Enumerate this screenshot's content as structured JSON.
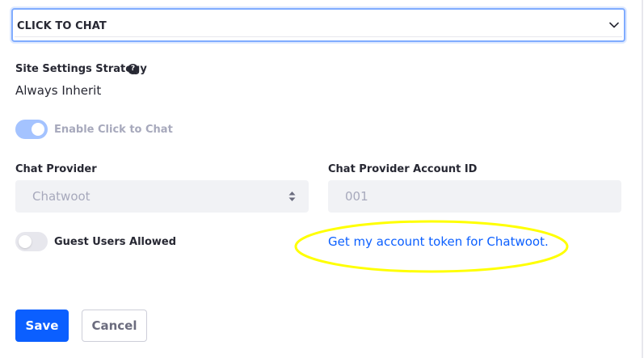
{
  "panel": {
    "title": "CLICK TO CHAT",
    "chevron_icon": "chevron-down-icon"
  },
  "site_settings": {
    "label": "Site Settings Strategy",
    "help_icon": "question-icon",
    "help_glyph": "?",
    "value": "Always Inherit"
  },
  "enable_toggle": {
    "label": "Enable Click to Chat",
    "checked": true,
    "disabled": true
  },
  "chat_provider": {
    "label": "Chat Provider",
    "selected": "Chatwoot"
  },
  "account_id": {
    "label": "Chat Provider Account ID",
    "value": "001"
  },
  "guest_toggle": {
    "label": "Guest Users Allowed",
    "checked": false
  },
  "token_link": {
    "text": "Get my account token for Chatwoot."
  },
  "highlight_color": "#ffff00",
  "actions": {
    "save": "Save",
    "cancel": "Cancel"
  },
  "colors": {
    "primary": "#0b5fff",
    "focus_border": "#80acff",
    "toggle_on": "#a4c3ff"
  }
}
